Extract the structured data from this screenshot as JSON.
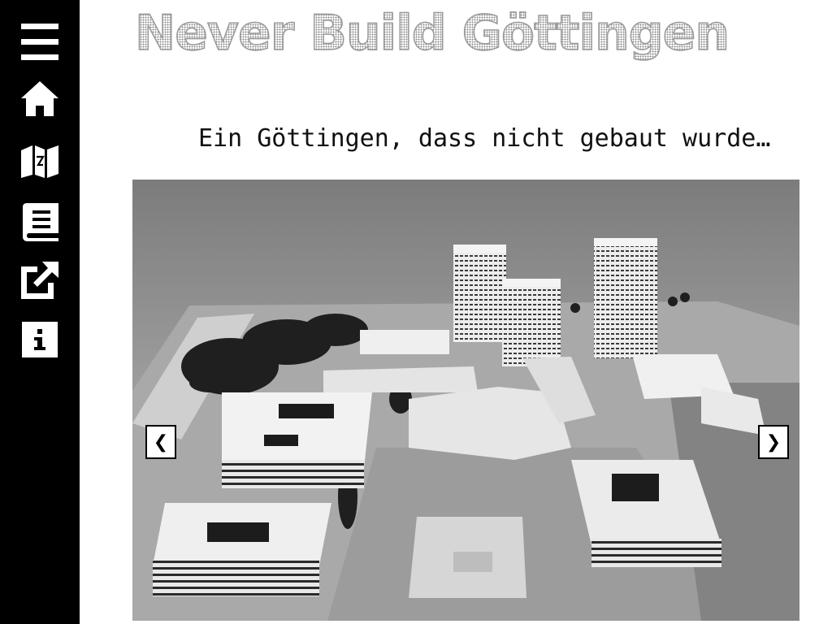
{
  "sidebar": {
    "items": [
      {
        "name": "menu-icon"
      },
      {
        "name": "home-icon"
      },
      {
        "name": "map-icon"
      },
      {
        "name": "book-icon"
      },
      {
        "name": "external-link-icon"
      },
      {
        "name": "info-icon"
      }
    ]
  },
  "header": {
    "title": "Never Build Göttingen",
    "subtitle": "Ein Göttingen, dass nicht gebaut wurde…"
  },
  "slider": {
    "image": "black-and-white-architectural-model-photo",
    "prev_label": "❮",
    "next_label": "❯"
  },
  "colors": {
    "sidebar_bg": "#000000",
    "icon": "#ffffff",
    "title_pattern": "#8e8e8e",
    "subtitle": "#111111"
  }
}
